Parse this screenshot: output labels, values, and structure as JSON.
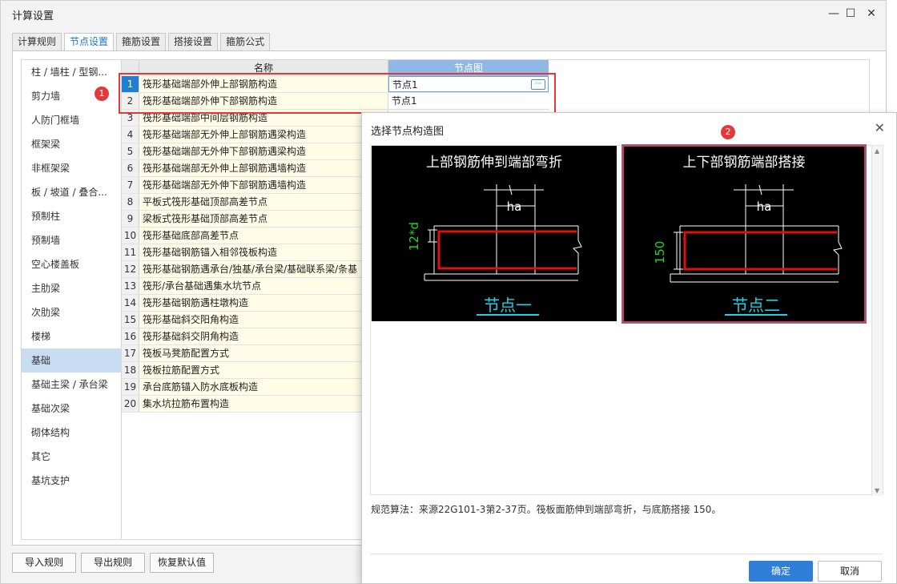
{
  "window": {
    "title": "计算设置",
    "minimize": "—",
    "maximize": "☐",
    "close": "✕"
  },
  "tabs": [
    {
      "label": "计算规则"
    },
    {
      "label": "节点设置"
    },
    {
      "label": "箍筋设置"
    },
    {
      "label": "搭接设置"
    },
    {
      "label": "箍筋公式"
    }
  ],
  "sidebar": {
    "items": [
      {
        "label": "柱 / 墙柱 / 型钢..."
      },
      {
        "label": "剪力墙"
      },
      {
        "label": "人防门框墙"
      },
      {
        "label": "框架梁"
      },
      {
        "label": "非框架梁"
      },
      {
        "label": "板 / 坡道 / 叠合..."
      },
      {
        "label": "预制柱"
      },
      {
        "label": "预制墙"
      },
      {
        "label": "空心楼盖板"
      },
      {
        "label": "主肋梁"
      },
      {
        "label": "次肋梁"
      },
      {
        "label": "楼梯"
      },
      {
        "label": "基础"
      },
      {
        "label": "基础主梁 / 承台梁"
      },
      {
        "label": "基础次梁"
      },
      {
        "label": "砌体结构"
      },
      {
        "label": "其它"
      },
      {
        "label": "基坑支护"
      }
    ]
  },
  "table": {
    "col_name": "名称",
    "col_node": "节点图",
    "rows": [
      {
        "num": "1",
        "name": "筏形基础端部外伸上部钢筋构造",
        "node": "节点1"
      },
      {
        "num": "2",
        "name": "筏形基础端部外伸下部钢筋构造",
        "node": "节点1"
      },
      {
        "num": "3",
        "name": "筏形基础端部中间层钢筋构造",
        "node": ""
      },
      {
        "num": "4",
        "name": "筏形基础端部无外伸上部钢筋遇梁构造",
        "node": ""
      },
      {
        "num": "5",
        "name": "筏形基础端部无外伸下部钢筋遇梁构造",
        "node": ""
      },
      {
        "num": "6",
        "name": "筏形基础端部无外伸上部钢筋遇墙构造",
        "node": ""
      },
      {
        "num": "7",
        "name": "筏形基础端部无外伸下部钢筋遇墙构造",
        "node": ""
      },
      {
        "num": "8",
        "name": "平板式筏形基础顶部高差节点",
        "node": ""
      },
      {
        "num": "9",
        "name": "梁板式筏形基础顶部高差节点",
        "node": ""
      },
      {
        "num": "10",
        "name": "筏形基础底部高差节点",
        "node": ""
      },
      {
        "num": "11",
        "name": "筏形基础钢筋锚入相邻筏板构造",
        "node": ""
      },
      {
        "num": "12",
        "name": "筏形基础钢筋遇承台/独基/承台梁/基础联系梁/条基",
        "node": ""
      },
      {
        "num": "13",
        "name": "筏形/承台基础遇集水坑节点",
        "node": ""
      },
      {
        "num": "14",
        "name": "筏形基础钢筋遇柱墩构造",
        "node": ""
      },
      {
        "num": "15",
        "name": "筏形基础斜交阳角构造",
        "node": ""
      },
      {
        "num": "16",
        "name": "筏形基础斜交阴角构造",
        "node": ""
      },
      {
        "num": "17",
        "name": "筏板马凳筋配置方式",
        "node": ""
      },
      {
        "num": "18",
        "name": "筏板拉筋配置方式",
        "node": ""
      },
      {
        "num": "19",
        "name": "承台底筋锚入防水底板构造",
        "node": ""
      },
      {
        "num": "20",
        "name": "集水坑拉筋布置构造",
        "node": ""
      }
    ],
    "more_button": "···"
  },
  "annotations": {
    "badge1": "1",
    "badge2": "2"
  },
  "bottom_buttons": {
    "import": "导入规则",
    "export": "导出规则",
    "restore": "恢复默认值"
  },
  "dialog": {
    "title": "选择节点构造图",
    "close": "✕",
    "node1": {
      "caption": "上部钢筋伸到端部弯折",
      "ha": "ha",
      "dim": "12*d",
      "label": "节点一"
    },
    "node2": {
      "caption": "上下部钢筋端部搭接",
      "ha": "ha",
      "dim": "150",
      "label": "节点二"
    },
    "note": "规范算法：来源22G101-3第2-37页。筏板面筋伸到端部弯折，与底筋搭接 150。",
    "ok": "确定",
    "cancel": "取消"
  },
  "colors": {
    "accent": "#2f7ed8",
    "highlight": "#e23a3a",
    "cad_green": "#22d422",
    "cad_cyan": "#19d3e6",
    "rebar_red": "#e01010"
  }
}
